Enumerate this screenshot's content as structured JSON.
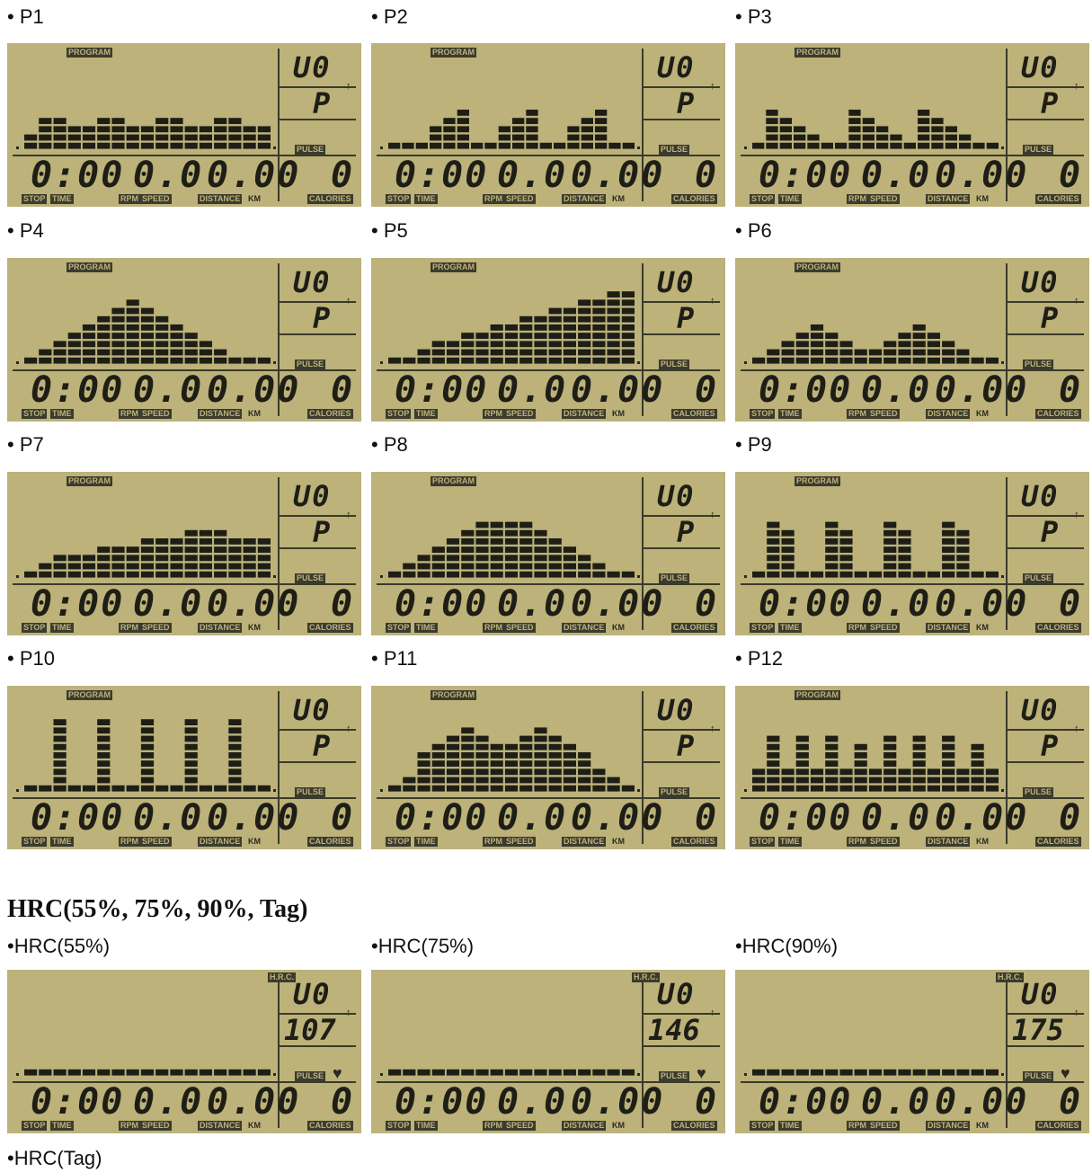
{
  "heading": "HRC(55%, 75%, 90%, Tag)",
  "lcd": {
    "program_tag": "PROGRAM",
    "hrc_tag": "H.R.C.",
    "pulse_tag": "PULSE",
    "stop_tag": "STOP",
    "time_tag": "TIME",
    "rpm_tag": "RPM",
    "speed_tag": "SPEED",
    "distance_tag": "DISTANCE",
    "km_tag": "KM",
    "calories_tag": "CALORIES",
    "level": "U0",
    "pulse_p": "P",
    "time": "0:00",
    "speed": "0.0",
    "distance": "0.00",
    "calories": "0"
  },
  "programs": [
    {
      "caption": "• P1",
      "levels": [
        2,
        4,
        4,
        3,
        3,
        4,
        4,
        3,
        3,
        4,
        4,
        3,
        3,
        4,
        4,
        3,
        3
      ]
    },
    {
      "caption": "• P2",
      "levels": [
        1,
        1,
        1,
        3,
        4,
        5,
        1,
        1,
        3,
        4,
        5,
        1,
        1,
        3,
        4,
        5,
        1,
        1
      ]
    },
    {
      "caption": "• P3",
      "levels": [
        1,
        5,
        4,
        3,
        2,
        1,
        1,
        5,
        4,
        3,
        2,
        1,
        5,
        4,
        3,
        2,
        1,
        1
      ]
    },
    {
      "caption": "• P4",
      "levels": [
        1,
        2,
        3,
        4,
        5,
        6,
        7,
        8,
        7,
        6,
        5,
        4,
        3,
        2,
        1,
        1,
        1
      ]
    },
    {
      "caption": "• P5",
      "levels": [
        1,
        1,
        2,
        3,
        3,
        4,
        4,
        5,
        5,
        6,
        6,
        7,
        7,
        8,
        8,
        9,
        9
      ]
    },
    {
      "caption": "• P6",
      "levels": [
        1,
        2,
        3,
        4,
        5,
        4,
        3,
        2,
        2,
        3,
        4,
        5,
        4,
        3,
        2,
        1,
        1
      ]
    },
    {
      "caption": "• P7",
      "levels": [
        1,
        2,
        3,
        3,
        3,
        4,
        4,
        4,
        5,
        5,
        5,
        6,
        6,
        6,
        5,
        5,
        5
      ]
    },
    {
      "caption": "• P8",
      "levels": [
        1,
        2,
        3,
        4,
        5,
        6,
        7,
        7,
        7,
        7,
        6,
        5,
        4,
        3,
        2,
        1,
        1
      ]
    },
    {
      "caption": "• P9",
      "levels": [
        1,
        7,
        6,
        1,
        1,
        7,
        6,
        1,
        1,
        7,
        6,
        1,
        1,
        7,
        6,
        1,
        1
      ]
    },
    {
      "caption": "• P10",
      "levels": [
        1,
        1,
        9,
        1,
        1,
        9,
        1,
        1,
        9,
        1,
        1,
        9,
        1,
        1,
        9,
        1,
        1
      ]
    },
    {
      "caption": "• P11",
      "levels": [
        1,
        2,
        5,
        6,
        7,
        8,
        7,
        6,
        6,
        7,
        8,
        7,
        6,
        5,
        3,
        2,
        1
      ]
    },
    {
      "caption": "• P12",
      "levels": [
        3,
        7,
        3,
        7,
        3,
        7,
        3,
        6,
        3,
        7,
        3,
        7,
        3,
        7,
        3,
        6,
        3
      ]
    }
  ],
  "hrc_panels": [
    {
      "caption": "•HRC(55%)",
      "pulse": "107"
    },
    {
      "caption": "•HRC(75%)",
      "pulse": "146"
    },
    {
      "caption": "•HRC(90%)",
      "pulse": "175"
    }
  ],
  "hrc_tag_caption": "•HRC(Tag)",
  "colors": {
    "lcd_bg": "#bcb27a",
    "lcd_ink": "#1e1e16"
  }
}
